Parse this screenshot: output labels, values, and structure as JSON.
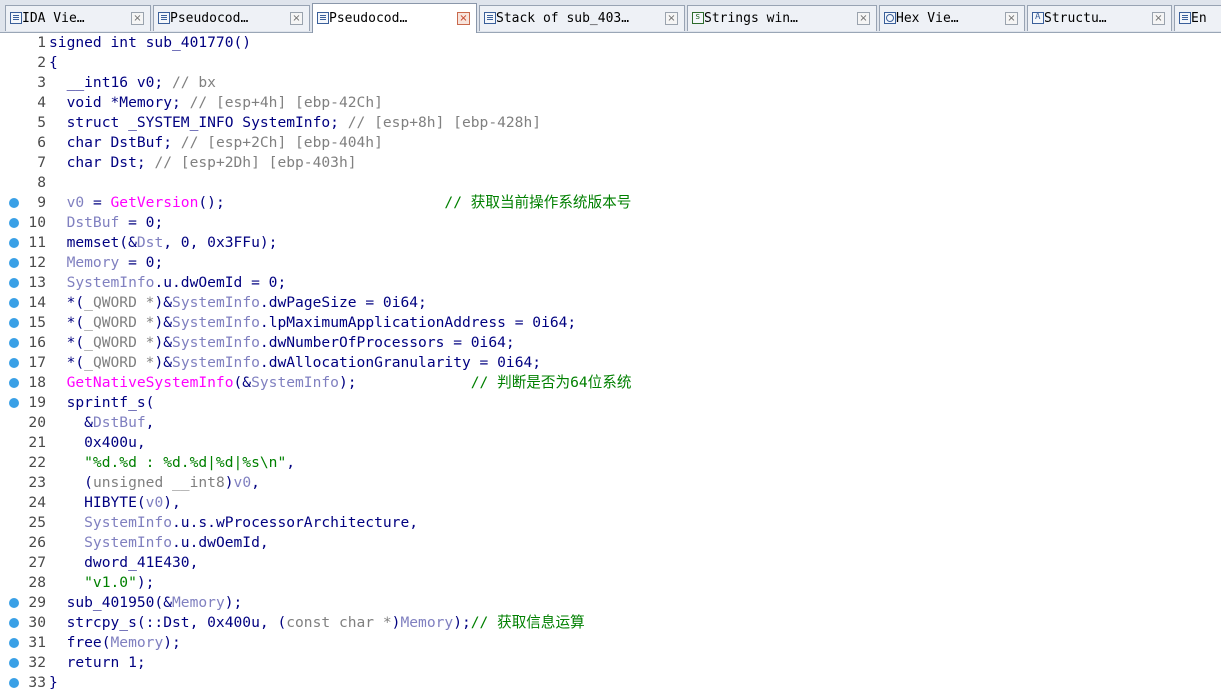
{
  "tabs": [
    {
      "label": "IDA Vie…",
      "icon": "ida-view-icon",
      "active": false
    },
    {
      "label": "Pseudocod…",
      "icon": "pseudocode-icon",
      "active": false
    },
    {
      "label": "Pseudocod…",
      "icon": "pseudocode-icon",
      "active": true
    },
    {
      "label": "Stack of sub_403…",
      "icon": "stack-icon",
      "active": false
    },
    {
      "label": "Strings win…",
      "icon": "strings-icon",
      "active": false
    },
    {
      "label": "Hex Vie…",
      "icon": "hex-view-icon",
      "active": false
    },
    {
      "label": "Structu…",
      "icon": "structures-icon",
      "active": false
    },
    {
      "label": "En",
      "icon": "enums-icon",
      "active": false
    }
  ],
  "colors": {
    "keyword": "#000080",
    "variable": "#8080c0",
    "function": "#ff00ff",
    "number": "#008000",
    "comment_ascii": "#808080",
    "comment_chinese": "#008000",
    "breakpoint": "#3aa0e6"
  },
  "code_lines": [
    {
      "n": 1,
      "bp": false,
      "tokens": [
        [
          "kw",
          "signed int sub_401770()"
        ]
      ]
    },
    {
      "n": 2,
      "bp": false,
      "tokens": [
        [
          "kw",
          "{"
        ]
      ]
    },
    {
      "n": 3,
      "bp": false,
      "tokens": [
        [
          "kw",
          "  __int16 v0; "
        ],
        [
          "cmt",
          "// bx"
        ]
      ]
    },
    {
      "n": 4,
      "bp": false,
      "tokens": [
        [
          "kw",
          "  void *Memory; "
        ],
        [
          "cmt",
          "// [esp+4h] [ebp-42Ch]"
        ]
      ]
    },
    {
      "n": 5,
      "bp": false,
      "tokens": [
        [
          "kw",
          "  struct _SYSTEM_INFO SystemInfo; "
        ],
        [
          "cmt",
          "// [esp+8h] [ebp-428h]"
        ]
      ]
    },
    {
      "n": 6,
      "bp": false,
      "tokens": [
        [
          "kw",
          "  char DstBuf; "
        ],
        [
          "cmt",
          "// [esp+2Ch] [ebp-404h]"
        ]
      ]
    },
    {
      "n": 7,
      "bp": false,
      "tokens": [
        [
          "kw",
          "  char Dst; "
        ],
        [
          "cmt",
          "// [esp+2Dh] [ebp-403h]"
        ]
      ]
    },
    {
      "n": 8,
      "bp": false,
      "tokens": []
    },
    {
      "n": 9,
      "bp": true,
      "tokens": [
        [
          "var",
          "  v0"
        ],
        [
          "kw",
          " = "
        ],
        [
          "fn",
          "GetVersion"
        ],
        [
          "kw",
          "();                         "
        ],
        [
          "cmtcn",
          "// 获取当前操作系统版本号"
        ]
      ]
    },
    {
      "n": 10,
      "bp": true,
      "tokens": [
        [
          "var",
          "  DstBuf"
        ],
        [
          "kw",
          " = 0;"
        ]
      ]
    },
    {
      "n": 11,
      "bp": true,
      "tokens": [
        [
          "kw",
          "  memset(&"
        ],
        [
          "var",
          "Dst"
        ],
        [
          "kw",
          ", 0, 0x3FFu);"
        ]
      ]
    },
    {
      "n": 12,
      "bp": true,
      "tokens": [
        [
          "var",
          "  Memory"
        ],
        [
          "kw",
          " = 0;"
        ]
      ]
    },
    {
      "n": 13,
      "bp": true,
      "tokens": [
        [
          "var",
          "  SystemInfo"
        ],
        [
          "kw",
          ".u.dwOemId = 0;"
        ]
      ]
    },
    {
      "n": 14,
      "bp": true,
      "tokens": [
        [
          "kw",
          "  *("
        ],
        [
          "cmt",
          "_QWORD *"
        ],
        [
          "kw",
          ")&"
        ],
        [
          "var",
          "SystemInfo"
        ],
        [
          "kw",
          ".dwPageSize = 0i64;"
        ]
      ]
    },
    {
      "n": 15,
      "bp": true,
      "tokens": [
        [
          "kw",
          "  *("
        ],
        [
          "cmt",
          "_QWORD *"
        ],
        [
          "kw",
          ")&"
        ],
        [
          "var",
          "SystemInfo"
        ],
        [
          "kw",
          ".lpMaximumApplicationAddress = 0i64;"
        ]
      ]
    },
    {
      "n": 16,
      "bp": true,
      "tokens": [
        [
          "kw",
          "  *("
        ],
        [
          "cmt",
          "_QWORD *"
        ],
        [
          "kw",
          ")&"
        ],
        [
          "var",
          "SystemInfo"
        ],
        [
          "kw",
          ".dwNumberOfProcessors = 0i64;"
        ]
      ]
    },
    {
      "n": 17,
      "bp": true,
      "tokens": [
        [
          "kw",
          "  *("
        ],
        [
          "cmt",
          "_QWORD *"
        ],
        [
          "kw",
          ")&"
        ],
        [
          "var",
          "SystemInfo"
        ],
        [
          "kw",
          ".dwAllocationGranularity = 0i64;"
        ]
      ]
    },
    {
      "n": 18,
      "bp": true,
      "tokens": [
        [
          "fn",
          "  GetNativeSystemInfo"
        ],
        [
          "kw",
          "(&"
        ],
        [
          "var",
          "SystemInfo"
        ],
        [
          "kw",
          ");             "
        ],
        [
          "cmtcn",
          "// 判断是否为64位系统"
        ]
      ]
    },
    {
      "n": 19,
      "bp": true,
      "tokens": [
        [
          "kw",
          "  sprintf_s("
        ]
      ]
    },
    {
      "n": 20,
      "bp": false,
      "tokens": [
        [
          "kw",
          "    &"
        ],
        [
          "var",
          "DstBuf"
        ],
        [
          "kw",
          ","
        ]
      ]
    },
    {
      "n": 21,
      "bp": false,
      "tokens": [
        [
          "kw",
          "    0x400u,"
        ]
      ]
    },
    {
      "n": 22,
      "bp": false,
      "tokens": [
        [
          "str",
          "    \"%d.%d : %d.%d|%d|%s\\n\""
        ],
        [
          "kw",
          ","
        ]
      ]
    },
    {
      "n": 23,
      "bp": false,
      "tokens": [
        [
          "kw",
          "    ("
        ],
        [
          "cmt",
          "unsigned __int8"
        ],
        [
          "kw",
          ")"
        ],
        [
          "var",
          "v0"
        ],
        [
          "kw",
          ","
        ]
      ]
    },
    {
      "n": 24,
      "bp": false,
      "tokens": [
        [
          "kw",
          "    HIBYTE("
        ],
        [
          "var",
          "v0"
        ],
        [
          "kw",
          "),"
        ]
      ]
    },
    {
      "n": 25,
      "bp": false,
      "tokens": [
        [
          "var",
          "    SystemInfo"
        ],
        [
          "kw",
          ".u.s.wProcessorArchitecture,"
        ]
      ]
    },
    {
      "n": 26,
      "bp": false,
      "tokens": [
        [
          "var",
          "    SystemInfo"
        ],
        [
          "kw",
          ".u.dwOemId,"
        ]
      ]
    },
    {
      "n": 27,
      "bp": false,
      "tokens": [
        [
          "kw",
          "    dword_41E430,"
        ]
      ]
    },
    {
      "n": 28,
      "bp": false,
      "tokens": [
        [
          "str",
          "    \"v1.0\""
        ],
        [
          "kw",
          ");"
        ]
      ]
    },
    {
      "n": 29,
      "bp": true,
      "tokens": [
        [
          "kw",
          "  sub_401950(&"
        ],
        [
          "var",
          "Memory"
        ],
        [
          "kw",
          ");"
        ]
      ]
    },
    {
      "n": 30,
      "bp": true,
      "tokens": [
        [
          "kw",
          "  strcpy_s(::Dst, 0x400u, ("
        ],
        [
          "cmt",
          "const char *"
        ],
        [
          "kw",
          ")"
        ],
        [
          "var",
          "Memory"
        ],
        [
          "kw",
          ");"
        ],
        [
          "cmtcn",
          "// 获取信息运算"
        ]
      ]
    },
    {
      "n": 31,
      "bp": true,
      "tokens": [
        [
          "kw",
          "  free("
        ],
        [
          "var",
          "Memory"
        ],
        [
          "kw",
          ");"
        ]
      ]
    },
    {
      "n": 32,
      "bp": true,
      "tokens": [
        [
          "kw",
          "  return 1;"
        ]
      ]
    },
    {
      "n": 33,
      "bp": true,
      "tokens": [
        [
          "kw",
          "}"
        ]
      ]
    }
  ]
}
